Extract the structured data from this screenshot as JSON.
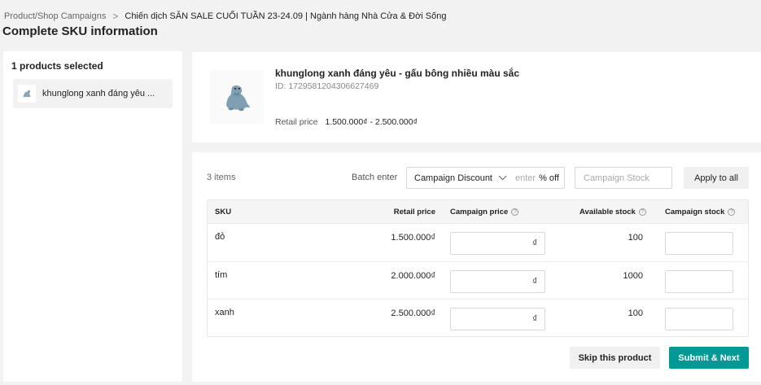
{
  "breadcrumb": {
    "parent": "Product/Shop Campaigns",
    "separator": ">",
    "current": "Chiến dịch SĂN SALE CUỐI TUẦN 23-24.09 | Ngành hàng Nhà Cửa & Đời Sống"
  },
  "page_title": "Complete SKU information",
  "sidebar": {
    "header": "1 products selected",
    "items": [
      {
        "label": "khunglong xanh đáng yêu ..."
      }
    ]
  },
  "product": {
    "name": "khunglong xanh đáng yêu - gấu bông nhiều màu sắc",
    "id": "ID: 1729581204306627469",
    "retail_label": "Retail price",
    "retail_value": "1.500.000₫ - 2.500.000₫",
    "image_icon": "dinosaur-plush-icon"
  },
  "batch": {
    "items_count": "3 items",
    "label": "Batch enter",
    "select_value": "Campaign Discount",
    "enter_placeholder": "enter",
    "unit": "% off",
    "stock_placeholder": "Campaign Stock",
    "apply_label": "Apply to all"
  },
  "table": {
    "headers": {
      "sku": "SKU",
      "retail_price": "Retail price",
      "campaign_price": "Campaign price",
      "available_stock": "Available stock",
      "campaign_stock": "Campaign stock"
    },
    "currency": "₫",
    "rows": [
      {
        "sku": "đỏ",
        "retail_price": "1.500.000₫",
        "available_stock": "100"
      },
      {
        "sku": "tím",
        "retail_price": "2.000.000₫",
        "available_stock": "1000"
      },
      {
        "sku": "xanh",
        "retail_price": "2.500.000₫",
        "available_stock": "100"
      }
    ]
  },
  "actions": {
    "skip_label": "Skip this product",
    "submit_label": "Submit & Next"
  },
  "colors": {
    "accent": "#009995",
    "page_background": "#f2f2f2"
  }
}
